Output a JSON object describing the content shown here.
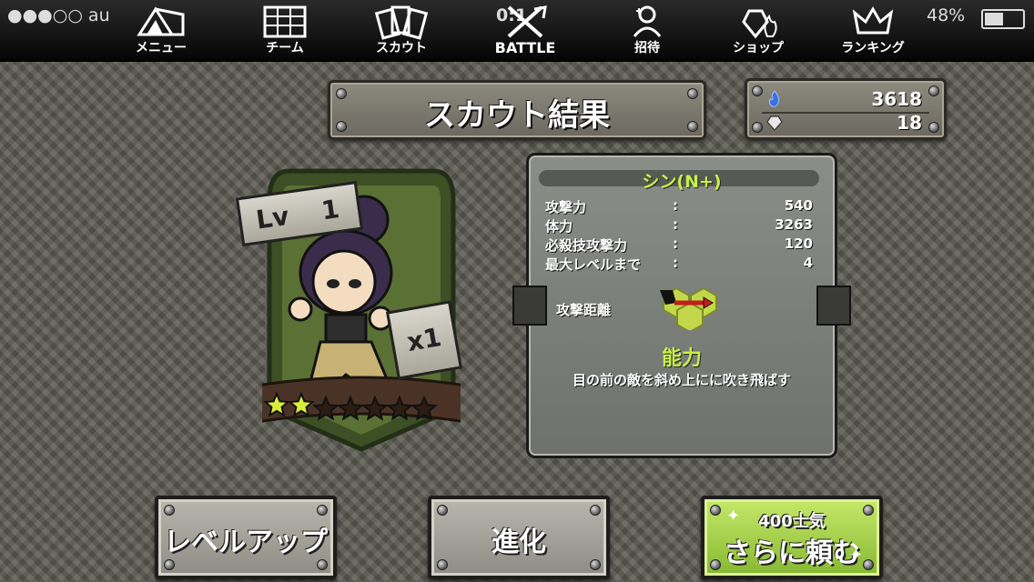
{
  "status_bar": {
    "carrier": "●●●○○ au",
    "time": "0:1",
    "battery": "48%"
  },
  "nav": [
    {
      "label": "メニュー",
      "icon": "tent-icon"
    },
    {
      "label": "チーム",
      "icon": "map-icon"
    },
    {
      "label": "スカウト",
      "icon": "cards-icon"
    },
    {
      "label": "BATTLE",
      "icon": "crossed-swords-icon"
    },
    {
      "label": "招待",
      "icon": "invite-person-icon"
    },
    {
      "label": "ショップ",
      "icon": "gem-flame-icon"
    },
    {
      "label": "ランキング",
      "icon": "crown-icon"
    }
  ],
  "title": "スカウト結果",
  "currency": {
    "fire": "3618",
    "crystal": "18"
  },
  "character": {
    "name": "シン(N+)",
    "level_label": "Lv",
    "level": "1",
    "count": "x1",
    "stars_filled": 2,
    "stars_total": 7,
    "stats": [
      {
        "label": "攻撃力",
        "sep": ":",
        "value": "540"
      },
      {
        "label": "体力",
        "sep": ":",
        "value": "3263"
      },
      {
        "label": "必殺技攻撃力",
        "sep": ":",
        "value": "120"
      },
      {
        "label": "最大レベルまで",
        "sep": ":",
        "value": "4"
      }
    ],
    "range_label": "攻撃距離",
    "ability_title": "能力",
    "ability_desc": "目の前の敵を斜め上にに吹き飛ばす"
  },
  "buttons": {
    "level_up": "レベルアップ",
    "evolve": "進化",
    "scout_cost": "400士気",
    "scout_more": "さらに頼む"
  },
  "colors": {
    "accent_green": "#c8f04a",
    "star_yellow": "#d8ec3a"
  }
}
